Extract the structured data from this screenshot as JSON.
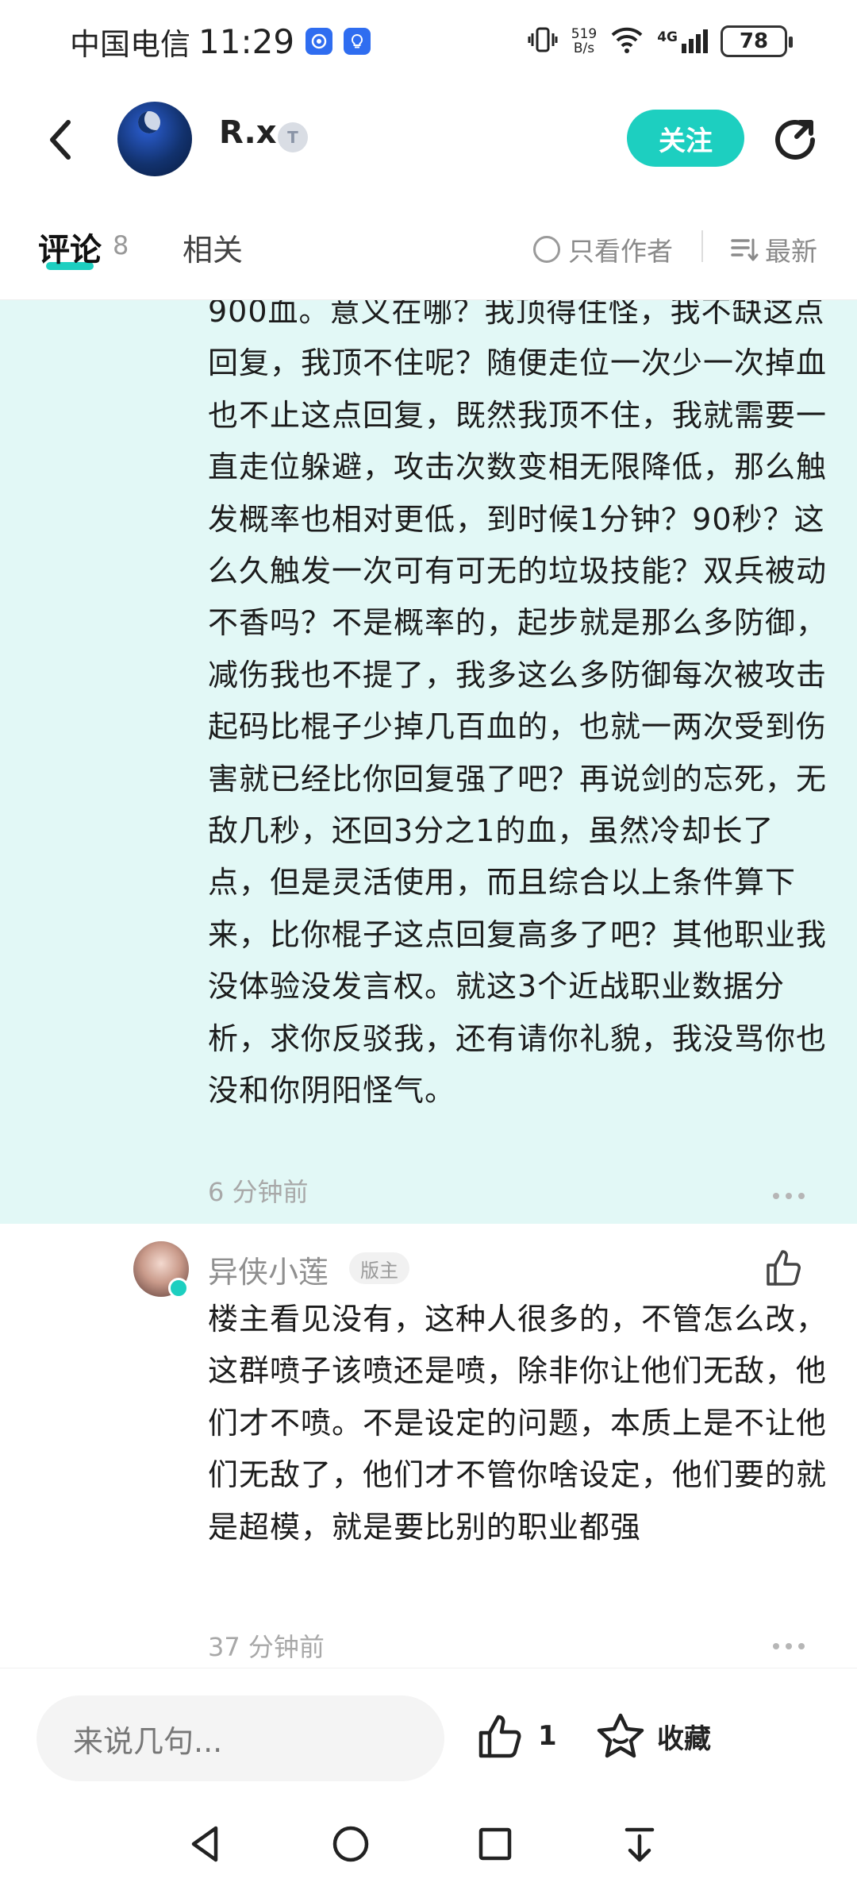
{
  "status_bar": {
    "carrier": "中国电信",
    "time": "11:29",
    "net_speed_value": "519",
    "net_speed_unit": "B/s",
    "network": "4G",
    "battery": "78"
  },
  "header": {
    "username": "R.x",
    "user_badge": "T",
    "follow_label": "关注"
  },
  "tabs": {
    "comments_label": "评论",
    "comments_count": "8",
    "related_label": "相关",
    "only_author_label": "只看作者",
    "sort_label": "最新"
  },
  "reply_highlight": {
    "text": "900血。意义在哪？我顶得住怪，我不缺这点回复，我顶不住呢？随便走位一次少一次掉血也不止这点回复，既然我顶不住，我就需要一直走位躲避，攻击次数变相无限降低，那么触发概率也相对更低，到时候1分钟？90秒？这么久触发一次可有可无的垃圾技能？双兵被动不香吗？不是概率的，起步就是那么多防御，减伤我也不提了，我多这么多防御每次被攻击起码比棍子少掉几百血的，也就一两次受到伤害就已经比你回复强了吧？再说剑的忘死，无敌几秒，还回3分之1的血，虽然冷却长了点，但是灵活使用，而且综合以上条件算下来，比你棍子这点回复高多了吧？其他职业我没体验没发言权。就这3个近战职业数据分析，求你反驳我，还有请你礼貌，我没骂你也没和你阴阳怪气。",
    "time": "6 分钟前"
  },
  "reply2": {
    "author": "异侠小莲",
    "author_tag": "版主",
    "text": "楼主看见没有，这种人很多的，不管怎么改，这群喷子该喷还是喷，除非你让他们无敌，他们才不喷。不是设定的问题，本质上是不让他们无敌了，他们才不管你啥设定，他们要的就是超模，就是要比别的职业都强",
    "time": "37 分钟前"
  },
  "bottom_bar": {
    "input_placeholder": "来说几句...",
    "like_count": "1",
    "favorite_label": "收藏"
  }
}
